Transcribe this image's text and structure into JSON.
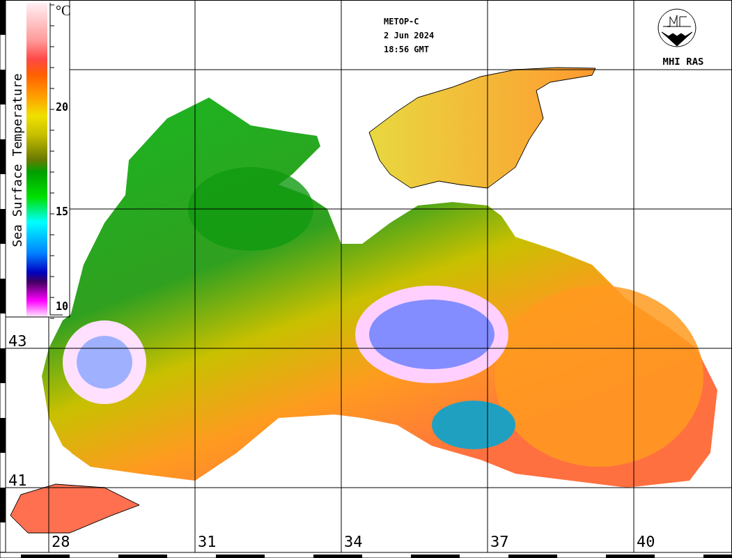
{
  "satellite_caption": {
    "lines": [
      "METOP-C",
      "2 Jun 2024",
      "18:56 GMT"
    ]
  },
  "logo": {
    "text": "MHI RAS"
  },
  "legend": {
    "title": "Sea Surface Temperature",
    "unit": "°C",
    "ticks": [
      "20",
      "15",
      "10"
    ]
  },
  "latitude_labels": [
    "43",
    "41"
  ],
  "longitude_labels": [
    "28",
    "31",
    "34",
    "37",
    "40"
  ]
}
